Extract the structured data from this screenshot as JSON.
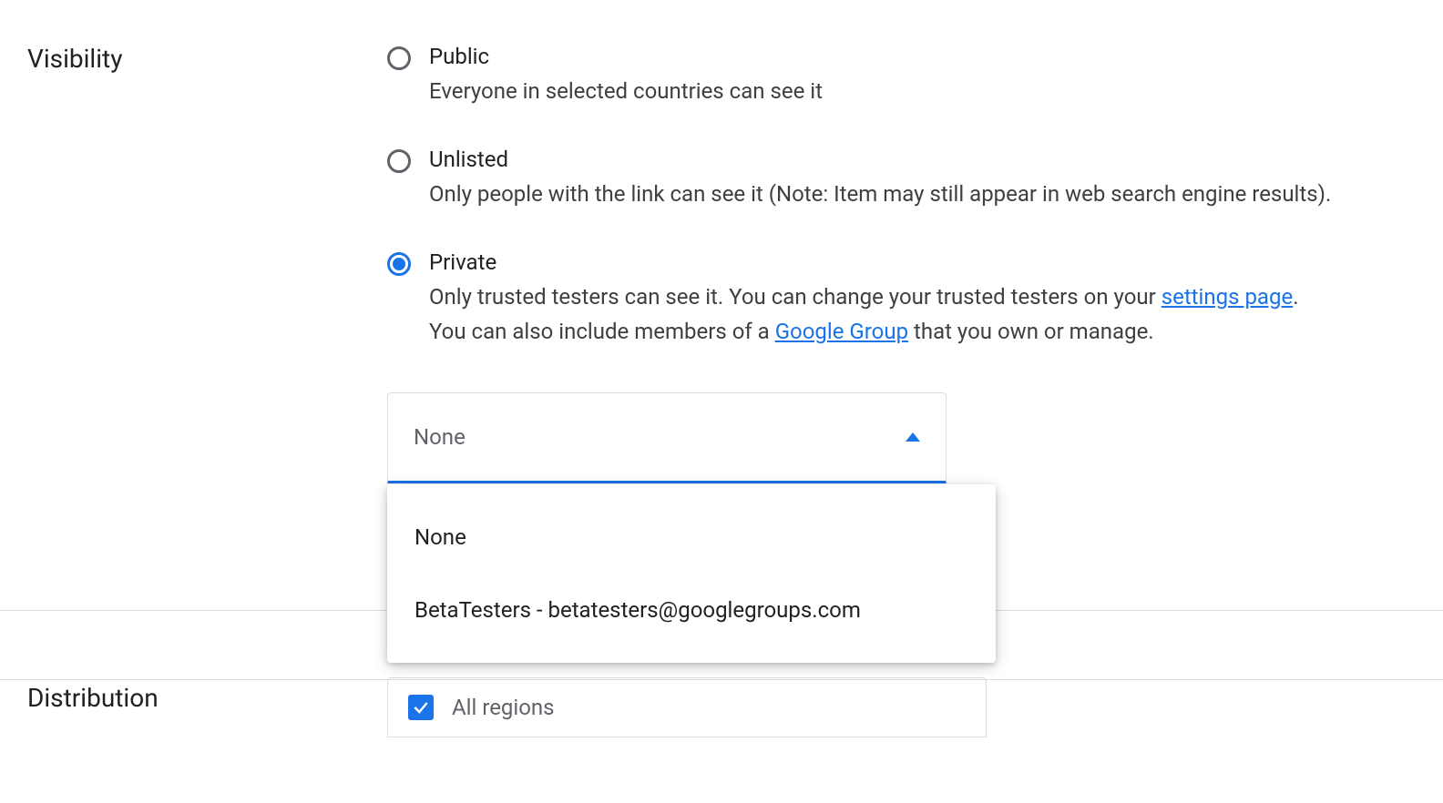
{
  "visibility": {
    "label": "Visibility",
    "options": [
      {
        "title": "Public",
        "desc": "Everyone in selected countries can see it",
        "selected": false
      },
      {
        "title": "Unlisted",
        "desc": "Only people with the link can see it (Note: Item may still appear in web search engine results).",
        "selected": false
      },
      {
        "title": "Private",
        "desc_part1": "Only trusted testers can see it. You can change your trusted testers on your ",
        "link1": "settings page",
        "desc_part2": ".",
        "desc_part3": "You can also include members of a ",
        "link2": "Google Group",
        "desc_part4": " that you own or manage.",
        "selected": true
      }
    ],
    "select": {
      "value": "None",
      "options": [
        "None",
        "BetaTesters - betatesters@googlegroups.com"
      ]
    }
  },
  "distribution": {
    "label": "Distribution",
    "checkbox_label": "All regions"
  }
}
